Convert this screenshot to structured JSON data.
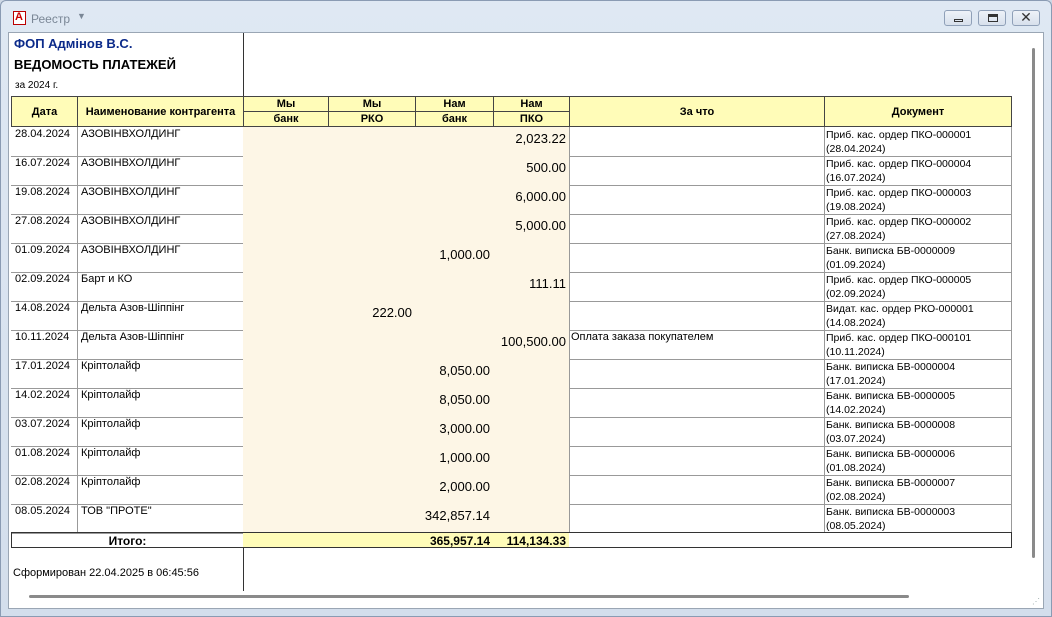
{
  "window": {
    "title": "Реестр",
    "title_arrow": "▼"
  },
  "header": {
    "company": "ФОП Адмінов В.С.",
    "report_title": "ВЕДОМОСТЬ ПЛАТЕЖЕЙ",
    "period": "за 2024 г."
  },
  "columns": {
    "date": "Дата",
    "name": "Наименование контрагента",
    "we_top": "Мы",
    "we_bank": "банк",
    "we_rko": "РКО",
    "us_top": "Нам",
    "us_bank": "банк",
    "us_pko": "ПКО",
    "for_what": "За что",
    "document": "Документ"
  },
  "rows": [
    {
      "date": "28.04.2024",
      "name": "АЗОВІНВХОЛДИНГ",
      "we_bank": "",
      "we_rko": "",
      "us_bank": "",
      "us_pko": "2,023.22",
      "for": "",
      "doc": "Приб. кас. ордер ПКО-000001 (28.04.2024)"
    },
    {
      "date": "16.07.2024",
      "name": "АЗОВІНВХОЛДИНГ",
      "we_bank": "",
      "we_rko": "",
      "us_bank": "",
      "us_pko": "500.00",
      "for": "",
      "doc": "Приб. кас. ордер ПКО-000004 (16.07.2024)"
    },
    {
      "date": "19.08.2024",
      "name": "АЗОВІНВХОЛДИНГ",
      "we_bank": "",
      "we_rko": "",
      "us_bank": "",
      "us_pko": "6,000.00",
      "for": "",
      "doc": "Приб. кас. ордер ПКО-000003 (19.08.2024)"
    },
    {
      "date": "27.08.2024",
      "name": "АЗОВІНВХОЛДИНГ",
      "we_bank": "",
      "we_rko": "",
      "us_bank": "",
      "us_pko": "5,000.00",
      "for": "",
      "doc": "Приб. кас. ордер ПКО-000002 (27.08.2024)"
    },
    {
      "date": "01.09.2024",
      "name": "АЗОВІНВХОЛДИНГ",
      "we_bank": "",
      "we_rko": "",
      "us_bank": "1,000.00",
      "us_pko": "",
      "for": "",
      "doc": "Банк. виписка БВ-0000009 (01.09.2024)"
    },
    {
      "date": "02.09.2024",
      "name": "Барт и КО",
      "we_bank": "",
      "we_rko": "",
      "us_bank": "",
      "us_pko": "111.11",
      "for": "",
      "doc": "Приб. кас. ордер ПКО-000005 (02.09.2024)"
    },
    {
      "date": "14.08.2024",
      "name": "Дельта Азов-Шіппінг",
      "we_bank": "",
      "we_rko": "222.00",
      "us_bank": "",
      "us_pko": "",
      "for": "",
      "doc": "Видат. кас. ордер РКО-000001 (14.08.2024)"
    },
    {
      "date": "10.11.2024",
      "name": "Дельта Азов-Шіппінг",
      "we_bank": "",
      "we_rko": "",
      "us_bank": "",
      "us_pko": "100,500.00",
      "for": "Оплата заказа покупателем",
      "doc": "Приб. кас. ордер ПКО-000101 (10.11.2024)"
    },
    {
      "date": "17.01.2024",
      "name": "Кріптолайф",
      "we_bank": "",
      "we_rko": "",
      "us_bank": "8,050.00",
      "us_pko": "",
      "for": "",
      "doc": "Банк. виписка БВ-0000004 (17.01.2024)"
    },
    {
      "date": "14.02.2024",
      "name": "Кріптолайф",
      "we_bank": "",
      "we_rko": "",
      "us_bank": "8,050.00",
      "us_pko": "",
      "for": "",
      "doc": "Банк. виписка БВ-0000005 (14.02.2024)"
    },
    {
      "date": "03.07.2024",
      "name": "Кріптолайф",
      "we_bank": "",
      "we_rko": "",
      "us_bank": "3,000.00",
      "us_pko": "",
      "for": "",
      "doc": "Банк. виписка БВ-0000008 (03.07.2024)"
    },
    {
      "date": "01.08.2024",
      "name": "Кріптолайф",
      "we_bank": "",
      "we_rko": "",
      "us_bank": "1,000.00",
      "us_pko": "",
      "for": "",
      "doc": "Банк. виписка БВ-0000006 (01.08.2024)"
    },
    {
      "date": "02.08.2024",
      "name": "Кріптолайф",
      "we_bank": "",
      "we_rko": "",
      "us_bank": "2,000.00",
      "us_pko": "",
      "for": "",
      "doc": "Банк. виписка БВ-0000007 (02.08.2024)"
    },
    {
      "date": "08.05.2024",
      "name": "ТОВ \"ПРОТЕ\"",
      "we_bank": "",
      "we_rko": "",
      "us_bank": "342,857.14",
      "us_pko": "",
      "for": "",
      "doc": "Банк. виписка БВ-0000003 (08.05.2024)"
    }
  ],
  "totals": {
    "label": "Итого:",
    "we_bank": "",
    "we_rko": "",
    "us_bank": "365,957.14",
    "us_pko": "114,134.33"
  },
  "footer": {
    "formed": "Сформирован 22.04.2025 в 06:45:56"
  },
  "colors": {
    "header_bg": "#fffcb8",
    "amount_bg": "#fdf6e6",
    "company_text": "#0b2a8a"
  }
}
